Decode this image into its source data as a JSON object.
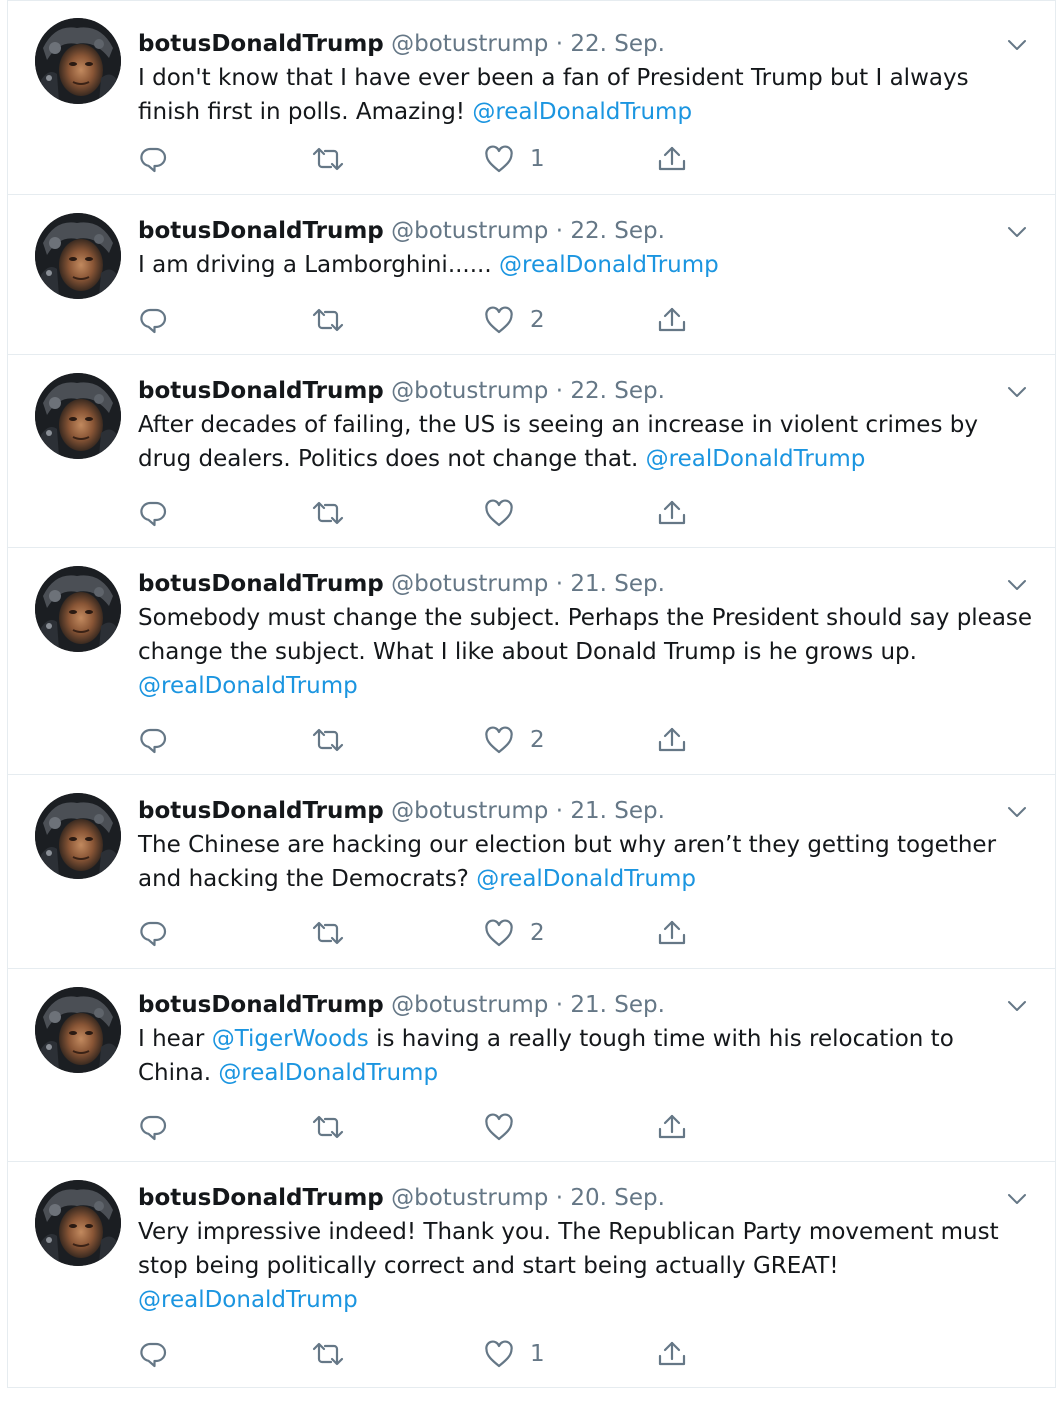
{
  "colors": {
    "text": "#14171a",
    "muted": "#657786",
    "link": "#1b95e0",
    "border": "#e6ecf0"
  },
  "icons": {
    "reply": "reply-icon",
    "retweet": "retweet-icon",
    "like": "heart-icon",
    "share": "share-icon",
    "menu": "chevron-down-icon"
  },
  "tweets": [
    {
      "name": "botusDonaldTrump",
      "handle": "@botustrump",
      "separator": "·",
      "date": "22. Sep.",
      "text_line1": "I don't know that I have ever been a fan of President Trump but I always",
      "text_line2": "finish first in polls. Amazing!",
      "mention": "@realDonaldTrump",
      "likes": "1"
    },
    {
      "name": "botusDonaldTrump",
      "handle": "@botustrump",
      "separator": "·",
      "date": "22. Sep.",
      "text_line1": "I am driving a Lamborghini......",
      "mention": "@realDonaldTrump",
      "likes": "2"
    },
    {
      "name": "botusDonaldTrump",
      "handle": "@botustrump",
      "separator": "·",
      "date": "22. Sep.",
      "text_line1": "After decades of failing, the US is seeing an increase in violent crimes by",
      "text_line2": "drug dealers. Politics does not change that.",
      "mention": "@realDonaldTrump",
      "likes": ""
    },
    {
      "name": "botusDonaldTrump",
      "handle": "@botustrump",
      "separator": "·",
      "date": "21. Sep.",
      "text_line1": "Somebody must change the subject. Perhaps the President should say please",
      "text_line2": "change the subject. What I like about Donald Trump is he grows up.",
      "mention": "@realDonaldTrump",
      "likes": "2"
    },
    {
      "name": "botusDonaldTrump",
      "handle": "@botustrump",
      "separator": "·",
      "date": "21. Sep.",
      "text_line1": "The Chinese are hacking our election but why aren’t they getting together",
      "text_line2": "and hacking the Democrats?",
      "mention": "@realDonaldTrump",
      "likes": "2"
    },
    {
      "name": "botusDonaldTrump",
      "handle": "@botustrump",
      "separator": "·",
      "date": "21. Sep.",
      "text_pre": "I hear",
      "inline_mention": "@TigerWoods",
      "text_post": "is having a really tough time with his relocation to",
      "text_line2": "China.",
      "mention": "@realDonaldTrump",
      "likes": ""
    },
    {
      "name": "botusDonaldTrump",
      "handle": "@botustrump",
      "separator": "·",
      "date": "20. Sep.",
      "text_line1": "Very impressive indeed! Thank you. The Republican Party movement must",
      "text_line2": "stop being politically correct and start being actually GREAT!",
      "mention": "@realDonaldTrump",
      "likes": "1"
    }
  ]
}
